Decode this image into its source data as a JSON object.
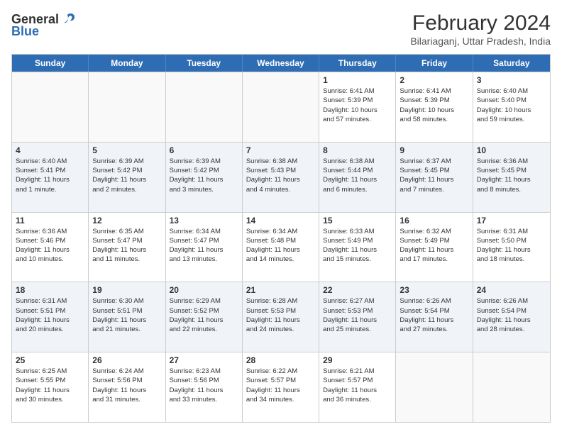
{
  "header": {
    "logo": {
      "line1": "General",
      "line2": "Blue"
    },
    "title": "February 2024",
    "location": "Bilariaganj, Uttar Pradesh, India"
  },
  "weekdays": [
    "Sunday",
    "Monday",
    "Tuesday",
    "Wednesday",
    "Thursday",
    "Friday",
    "Saturday"
  ],
  "rows": [
    {
      "alt": false,
      "cells": [
        {
          "day": "",
          "info": ""
        },
        {
          "day": "",
          "info": ""
        },
        {
          "day": "",
          "info": ""
        },
        {
          "day": "",
          "info": ""
        },
        {
          "day": "1",
          "info": "Sunrise: 6:41 AM\nSunset: 5:39 PM\nDaylight: 10 hours\nand 57 minutes."
        },
        {
          "day": "2",
          "info": "Sunrise: 6:41 AM\nSunset: 5:39 PM\nDaylight: 10 hours\nand 58 minutes."
        },
        {
          "day": "3",
          "info": "Sunrise: 6:40 AM\nSunset: 5:40 PM\nDaylight: 10 hours\nand 59 minutes."
        }
      ]
    },
    {
      "alt": true,
      "cells": [
        {
          "day": "4",
          "info": "Sunrise: 6:40 AM\nSunset: 5:41 PM\nDaylight: 11 hours\nand 1 minute."
        },
        {
          "day": "5",
          "info": "Sunrise: 6:39 AM\nSunset: 5:42 PM\nDaylight: 11 hours\nand 2 minutes."
        },
        {
          "day": "6",
          "info": "Sunrise: 6:39 AM\nSunset: 5:42 PM\nDaylight: 11 hours\nand 3 minutes."
        },
        {
          "day": "7",
          "info": "Sunrise: 6:38 AM\nSunset: 5:43 PM\nDaylight: 11 hours\nand 4 minutes."
        },
        {
          "day": "8",
          "info": "Sunrise: 6:38 AM\nSunset: 5:44 PM\nDaylight: 11 hours\nand 6 minutes."
        },
        {
          "day": "9",
          "info": "Sunrise: 6:37 AM\nSunset: 5:45 PM\nDaylight: 11 hours\nand 7 minutes."
        },
        {
          "day": "10",
          "info": "Sunrise: 6:36 AM\nSunset: 5:45 PM\nDaylight: 11 hours\nand 8 minutes."
        }
      ]
    },
    {
      "alt": false,
      "cells": [
        {
          "day": "11",
          "info": "Sunrise: 6:36 AM\nSunset: 5:46 PM\nDaylight: 11 hours\nand 10 minutes."
        },
        {
          "day": "12",
          "info": "Sunrise: 6:35 AM\nSunset: 5:47 PM\nDaylight: 11 hours\nand 11 minutes."
        },
        {
          "day": "13",
          "info": "Sunrise: 6:34 AM\nSunset: 5:47 PM\nDaylight: 11 hours\nand 13 minutes."
        },
        {
          "day": "14",
          "info": "Sunrise: 6:34 AM\nSunset: 5:48 PM\nDaylight: 11 hours\nand 14 minutes."
        },
        {
          "day": "15",
          "info": "Sunrise: 6:33 AM\nSunset: 5:49 PM\nDaylight: 11 hours\nand 15 minutes."
        },
        {
          "day": "16",
          "info": "Sunrise: 6:32 AM\nSunset: 5:49 PM\nDaylight: 11 hours\nand 17 minutes."
        },
        {
          "day": "17",
          "info": "Sunrise: 6:31 AM\nSunset: 5:50 PM\nDaylight: 11 hours\nand 18 minutes."
        }
      ]
    },
    {
      "alt": true,
      "cells": [
        {
          "day": "18",
          "info": "Sunrise: 6:31 AM\nSunset: 5:51 PM\nDaylight: 11 hours\nand 20 minutes."
        },
        {
          "day": "19",
          "info": "Sunrise: 6:30 AM\nSunset: 5:51 PM\nDaylight: 11 hours\nand 21 minutes."
        },
        {
          "day": "20",
          "info": "Sunrise: 6:29 AM\nSunset: 5:52 PM\nDaylight: 11 hours\nand 22 minutes."
        },
        {
          "day": "21",
          "info": "Sunrise: 6:28 AM\nSunset: 5:53 PM\nDaylight: 11 hours\nand 24 minutes."
        },
        {
          "day": "22",
          "info": "Sunrise: 6:27 AM\nSunset: 5:53 PM\nDaylight: 11 hours\nand 25 minutes."
        },
        {
          "day": "23",
          "info": "Sunrise: 6:26 AM\nSunset: 5:54 PM\nDaylight: 11 hours\nand 27 minutes."
        },
        {
          "day": "24",
          "info": "Sunrise: 6:26 AM\nSunset: 5:54 PM\nDaylight: 11 hours\nand 28 minutes."
        }
      ]
    },
    {
      "alt": false,
      "cells": [
        {
          "day": "25",
          "info": "Sunrise: 6:25 AM\nSunset: 5:55 PM\nDaylight: 11 hours\nand 30 minutes."
        },
        {
          "day": "26",
          "info": "Sunrise: 6:24 AM\nSunset: 5:56 PM\nDaylight: 11 hours\nand 31 minutes."
        },
        {
          "day": "27",
          "info": "Sunrise: 6:23 AM\nSunset: 5:56 PM\nDaylight: 11 hours\nand 33 minutes."
        },
        {
          "day": "28",
          "info": "Sunrise: 6:22 AM\nSunset: 5:57 PM\nDaylight: 11 hours\nand 34 minutes."
        },
        {
          "day": "29",
          "info": "Sunrise: 6:21 AM\nSunset: 5:57 PM\nDaylight: 11 hours\nand 36 minutes."
        },
        {
          "day": "",
          "info": ""
        },
        {
          "day": "",
          "info": ""
        }
      ]
    }
  ]
}
